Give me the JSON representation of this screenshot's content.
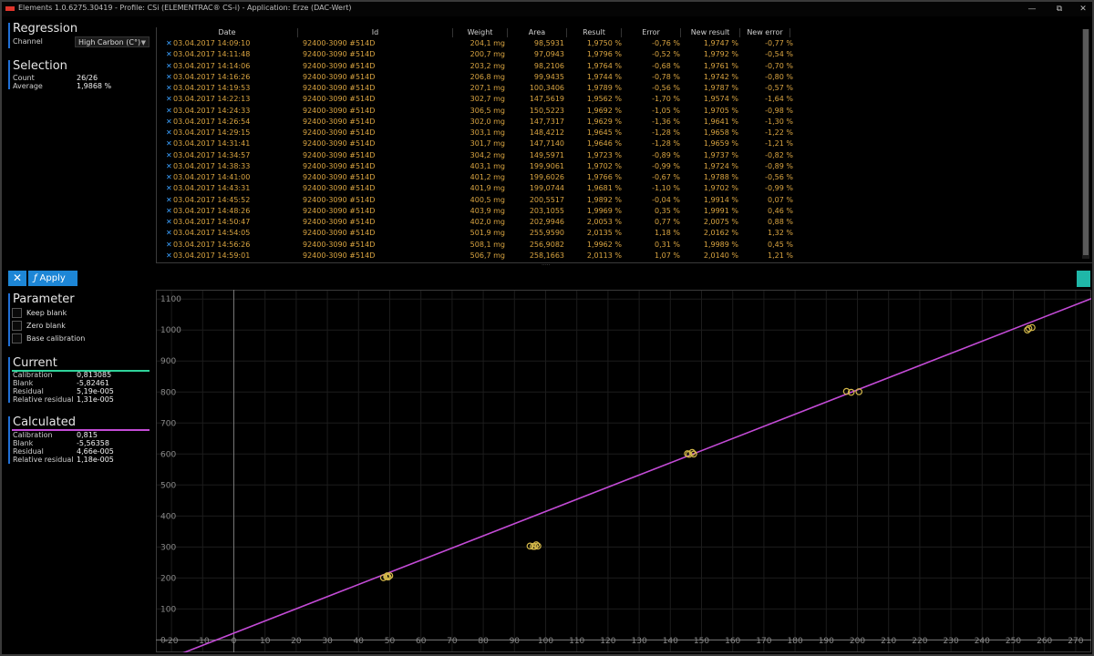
{
  "window": {
    "title": "Elements 1.0.6275.30419 - Profile: CSi (ELEMENTRAC® CS-i) - Application: Erze (DAC-Wert)",
    "min_label": "—",
    "max_label": "⧉",
    "close_label": "✕"
  },
  "regression": {
    "title": "Regression",
    "channel_label": "Channel",
    "channel_value": "High Carbon (C°)"
  },
  "selection": {
    "title": "Selection",
    "count_label": "Count",
    "count_value": "26/26",
    "average_label": "Average",
    "average_value": "1,9868 %"
  },
  "actions": {
    "clear_icon": "✕",
    "apply_label": "Apply",
    "apply_icon": "ƒ"
  },
  "parameter": {
    "title": "Parameter",
    "options": [
      "Keep blank",
      "Zero blank",
      "Base calibration"
    ]
  },
  "current": {
    "title": "Current",
    "accent_color": "#2fd39a",
    "rows": [
      {
        "k": "Calibration",
        "v": "0,813085"
      },
      {
        "k": "Blank",
        "v": "-5,82461"
      },
      {
        "k": "Residual",
        "v": "5,19e-005"
      },
      {
        "k": "Relative residual",
        "v": "1,31e-005"
      }
    ]
  },
  "calculated": {
    "title": "Calculated",
    "accent_color": "#c34bd6",
    "rows": [
      {
        "k": "Calibration",
        "v": "0,815"
      },
      {
        "k": "Blank",
        "v": "-5,56358"
      },
      {
        "k": "Residual",
        "v": "4,66e-005"
      },
      {
        "k": "Relative residual",
        "v": "1,18e-005"
      }
    ]
  },
  "table": {
    "columns": [
      "Date",
      "Id",
      "Weight",
      "Area",
      "Result",
      "Error",
      "New result",
      "New error"
    ],
    "row_marker": "✕",
    "rows": [
      [
        "03.04.2017 14:09:10",
        "92400-3090 #514D",
        "204,1 mg",
        "98,5931",
        "1,9750 %",
        "-0,76 %",
        "1,9747 %",
        "-0,77 %"
      ],
      [
        "03.04.2017 14:11:48",
        "92400-3090 #514D",
        "200,7 mg",
        "97,0943",
        "1,9796 %",
        "-0,52 %",
        "1,9792 %",
        "-0,54 %"
      ],
      [
        "03.04.2017 14:14:06",
        "92400-3090 #514D",
        "203,2 mg",
        "98,2106",
        "1,9764 %",
        "-0,68 %",
        "1,9761 %",
        "-0,70 %"
      ],
      [
        "03.04.2017 14:16:26",
        "92400-3090 #514D",
        "206,8 mg",
        "99,9435",
        "1,9744 %",
        "-0,78 %",
        "1,9742 %",
        "-0,80 %"
      ],
      [
        "03.04.2017 14:19:53",
        "92400-3090 #514D",
        "207,1 mg",
        "100,3406",
        "1,9789 %",
        "-0,56 %",
        "1,9787 %",
        "-0,57 %"
      ],
      [
        "03.04.2017 14:22:13",
        "92400-3090 #514D",
        "302,7 mg",
        "147,5619",
        "1,9562 %",
        "-1,70 %",
        "1,9574 %",
        "-1,64 %"
      ],
      [
        "03.04.2017 14:24:33",
        "92400-3090 #514D",
        "306,5 mg",
        "150,5223",
        "1,9692 %",
        "-1,05 %",
        "1,9705 %",
        "-0,98 %"
      ],
      [
        "03.04.2017 14:26:54",
        "92400-3090 #514D",
        "302,0 mg",
        "147,7317",
        "1,9629 %",
        "-1,36 %",
        "1,9641 %",
        "-1,30 %"
      ],
      [
        "03.04.2017 14:29:15",
        "92400-3090 #514D",
        "303,1 mg",
        "148,4212",
        "1,9645 %",
        "-1,28 %",
        "1,9658 %",
        "-1,22 %"
      ],
      [
        "03.04.2017 14:31:41",
        "92400-3090 #514D",
        "301,7 mg",
        "147,7140",
        "1,9646 %",
        "-1,28 %",
        "1,9659 %",
        "-1,21 %"
      ],
      [
        "03.04.2017 14:34:57",
        "92400-3090 #514D",
        "304,2 mg",
        "149,5971",
        "1,9723 %",
        "-0,89 %",
        "1,9737 %",
        "-0,82 %"
      ],
      [
        "03.04.2017 14:38:33",
        "92400-3090 #514D",
        "403,1 mg",
        "199,9061",
        "1,9702 %",
        "-0,99 %",
        "1,9724 %",
        "-0,89 %"
      ],
      [
        "03.04.2017 14:41:00",
        "92400-3090 #514D",
        "401,2 mg",
        "199,6026",
        "1,9766 %",
        "-0,67 %",
        "1,9788 %",
        "-0,56 %"
      ],
      [
        "03.04.2017 14:43:31",
        "92400-3090 #514D",
        "401,9 mg",
        "199,0744",
        "1,9681 %",
        "-1,10 %",
        "1,9702 %",
        "-0,99 %"
      ],
      [
        "03.04.2017 14:45:52",
        "92400-3090 #514D",
        "400,5 mg",
        "200,5517",
        "1,9892 %",
        "-0,04 %",
        "1,9914 %",
        "0,07 %"
      ],
      [
        "03.04.2017 14:48:26",
        "92400-3090 #514D",
        "403,9 mg",
        "203,1055",
        "1,9969 %",
        "0,35 %",
        "1,9991 %",
        "0,46 %"
      ],
      [
        "03.04.2017 14:50:47",
        "92400-3090 #514D",
        "402,0 mg",
        "202,9946",
        "2,0053 %",
        "0,77 %",
        "2,0075 %",
        "0,88 %"
      ],
      [
        "03.04.2017 14:54:05",
        "92400-3090 #514D",
        "501,9 mg",
        "255,9590",
        "2,0135 %",
        "1,18 %",
        "2,0162 %",
        "1,32 %"
      ],
      [
        "03.04.2017 14:56:26",
        "92400-3090 #514D",
        "508,1 mg",
        "256,9082",
        "1,9962 %",
        "0,31 %",
        "1,9989 %",
        "0,45 %"
      ],
      [
        "03.04.2017 14:59:01",
        "92400-3090 #514D",
        "506,7 mg",
        "258,1663",
        "2,0113 %",
        "1,07 %",
        "2,0140 %",
        "1,21 %"
      ]
    ]
  },
  "splitter": {
    "grip": "·····"
  },
  "chart_data": {
    "type": "scatter",
    "title": "",
    "xlabel": "",
    "ylabel": "",
    "xlim": [
      -25,
      275
    ],
    "ylim": [
      -40,
      1130
    ],
    "x_ticks": [
      -20,
      -10,
      0,
      10,
      20,
      30,
      40,
      50,
      60,
      70,
      80,
      90,
      100,
      110,
      120,
      130,
      140,
      150,
      160,
      170,
      180,
      190,
      200,
      210,
      220,
      230,
      240,
      250,
      260,
      270
    ],
    "y_ticks": [
      0,
      100,
      200,
      300,
      400,
      500,
      600,
      700,
      800,
      900,
      1000,
      1100
    ],
    "grid": true,
    "point_color": "#d4b84a",
    "line_color": "#c34bd6",
    "points": [
      [
        49,
        204
      ],
      [
        48,
        201
      ],
      [
        49.5,
        203
      ],
      [
        50,
        207
      ],
      [
        49.2,
        207
      ],
      [
        95,
        303
      ],
      [
        97,
        307
      ],
      [
        96,
        302
      ],
      [
        97.5,
        303
      ],
      [
        96.5,
        302
      ],
      [
        145.5,
        601
      ],
      [
        147,
        605
      ],
      [
        147.5,
        600
      ],
      [
        146,
        599
      ],
      [
        196.5,
        802
      ],
      [
        198,
        799
      ],
      [
        200.5,
        801
      ],
      [
        254.5,
        1000
      ],
      [
        256,
        1008
      ],
      [
        255,
        1005
      ]
    ],
    "fit_line": {
      "slope": 3.925,
      "intercept": 22
    }
  }
}
